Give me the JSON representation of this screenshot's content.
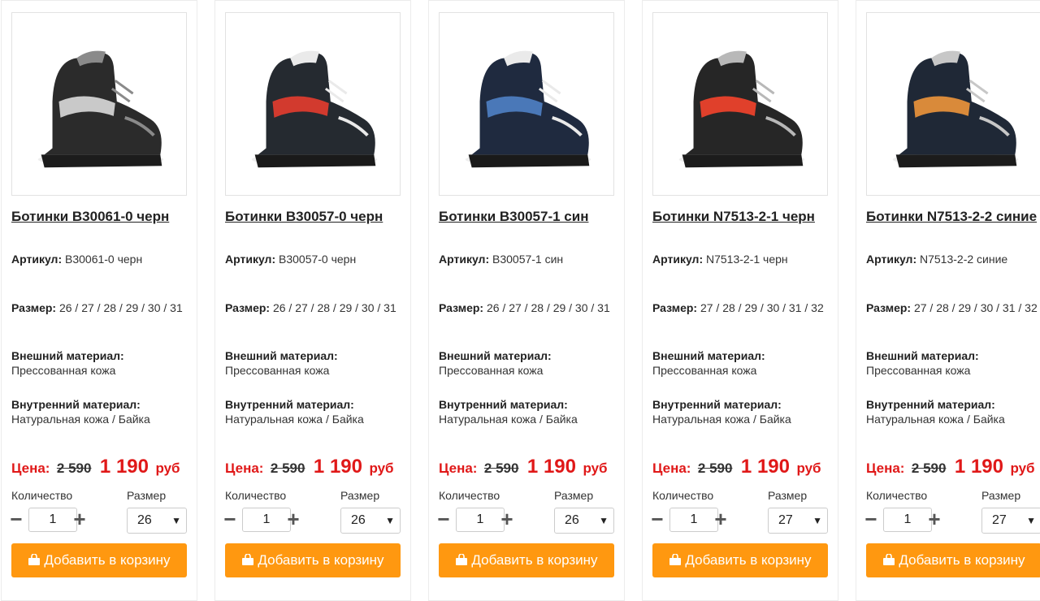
{
  "labels": {
    "article": "Артикул:",
    "size": "Размер:",
    "outer_material": "Внешний материал:",
    "inner_material": "Внутренний материал:",
    "price": "Цена:",
    "currency": "руб",
    "quantity": "Количество",
    "size_select": "Размер",
    "add_to_cart": "Добавить в корзину",
    "minus": "−",
    "plus": "+",
    "chevron": "▼"
  },
  "colors": {
    "accent_button": "#ff9810",
    "price_red": "#e01818"
  },
  "products": [
    {
      "title": "Ботинки B30061-0 черн",
      "article": "B30061-0 черн",
      "sizes": "26 / 27 / 28 / 29 / 30 / 31",
      "outer_material": "Прессованная кожа",
      "inner_material": "Натуральная кожа / Байка",
      "old_price": "2 590",
      "new_price": "1 190",
      "quantity": "1",
      "selected_size": "26",
      "boot_colors": {
        "body": "#2b2b2b",
        "accent": "#c9c9c9",
        "sole": "#1c1c1c",
        "trim": "#8a8a8a"
      }
    },
    {
      "title": "Ботинки B30057-0 черн",
      "article": "B30057-0 черн",
      "sizes": "26 / 27 / 28 / 29 / 30 / 31",
      "outer_material": "Прессованная кожа",
      "inner_material": "Натуральная кожа / Байка",
      "old_price": "2 590",
      "new_price": "1 190",
      "quantity": "1",
      "selected_size": "26",
      "boot_colors": {
        "body": "#252a30",
        "accent": "#d23a2e",
        "sole": "#1a1a1a",
        "trim": "#eaeaea"
      }
    },
    {
      "title": "Ботинки B30057-1 син",
      "article": "B30057-1 син",
      "sizes": "26 / 27 / 28 / 29 / 30 / 31",
      "outer_material": "Прессованная кожа",
      "inner_material": "Натуральная кожа / Байка",
      "old_price": "2 590",
      "new_price": "1 190",
      "quantity": "1",
      "selected_size": "26",
      "boot_colors": {
        "body": "#1f2a3f",
        "accent": "#4a78b8",
        "sole": "#1a1a1a",
        "trim": "#eaeaea"
      }
    },
    {
      "title": "Ботинки N7513-2-1 черн",
      "article": "N7513-2-1 черн",
      "sizes": "27 / 28 / 29 / 30 / 31 / 32",
      "outer_material": "Прессованная кожа",
      "inner_material": "Натуральная кожа / Байка",
      "old_price": "2 590",
      "new_price": "1 190",
      "quantity": "1",
      "selected_size": "27",
      "boot_colors": {
        "body": "#262626",
        "accent": "#e0402b",
        "sole": "#1c1c1c",
        "trim": "#b8b8b8"
      }
    },
    {
      "title": "Ботинки N7513-2-2 синие",
      "article": "N7513-2-2 синие",
      "sizes": "27 / 28 / 29 / 30 / 31 / 32",
      "outer_material": "Прессованная кожа",
      "inner_material": "Натуральная кожа / Байка",
      "old_price": "2 590",
      "new_price": "1 190",
      "quantity": "1",
      "selected_size": "27",
      "boot_colors": {
        "body": "#1f2836",
        "accent": "#d98a3a",
        "sole": "#1c1c1c",
        "trim": "#c7c7c7"
      }
    }
  ]
}
